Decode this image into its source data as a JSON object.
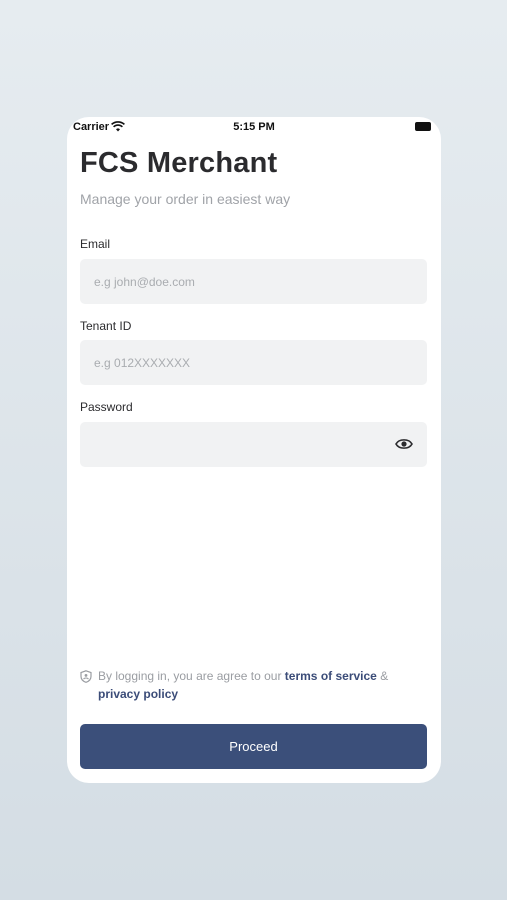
{
  "status_bar": {
    "carrier": "Carrier",
    "time": "5:15 PM"
  },
  "header": {
    "title": "FCS Merchant",
    "subtitle": "Manage your order in easiest way"
  },
  "form": {
    "email": {
      "label": "Email",
      "placeholder": "e.g john@doe.com",
      "value": ""
    },
    "tenant": {
      "label": "Tenant ID",
      "placeholder": "e.g 012XXXXXXX",
      "value": ""
    },
    "password": {
      "label": "Password",
      "placeholder": "",
      "value": ""
    }
  },
  "terms": {
    "prefix": "By logging in, you are agree to our ",
    "terms_link": "terms of service",
    "joiner": " & ",
    "privacy_link": "privacy policy"
  },
  "actions": {
    "proceed_label": "Proceed"
  },
  "colors": {
    "primary": "#3b4f7a",
    "field_bg": "#f1f2f3",
    "link": "#3b4c78"
  },
  "icons": [
    "wifi-icon",
    "battery-icon",
    "eye-icon",
    "shield-icon"
  ]
}
